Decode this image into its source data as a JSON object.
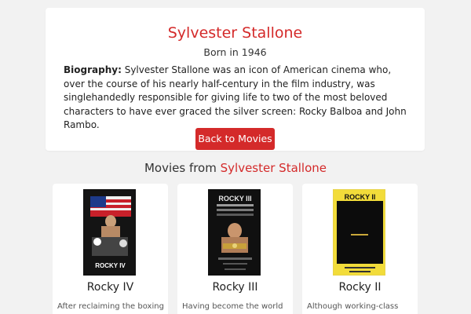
{
  "actor": {
    "name": "Sylvester Stallone",
    "born": "Born in 1946",
    "bio_label": "Biography:",
    "bio_text": "Sylvester Stallone was an icon of American cinema who, over the course of his nearly half-century in the film industry, was singlehandedly responsible for giving life to two of the most beloved characters to have ever graced the silver screen: Rocky Balboa and John Rambo."
  },
  "back_button": "Back to Movies",
  "movies_section": {
    "heading_prefix": "Movies from",
    "heading_name": "Sylvester Stallone"
  },
  "movies": [
    {
      "title": "Rocky IV",
      "description": "After reclaiming the boxing champ...",
      "poster_text": "ROCKY IV"
    },
    {
      "title": "Rocky III",
      "description": "Having become the world heavyweight champ...",
      "poster_text": "ROCKY III"
    },
    {
      "title": "Rocky II",
      "description": "Although working-class Philadelphia boxer Rocky...",
      "poster_text": "ROCKY II"
    }
  ],
  "colors": {
    "accent": "#d42a2a",
    "background": "#f2f2f2",
    "card": "#ffffff"
  }
}
